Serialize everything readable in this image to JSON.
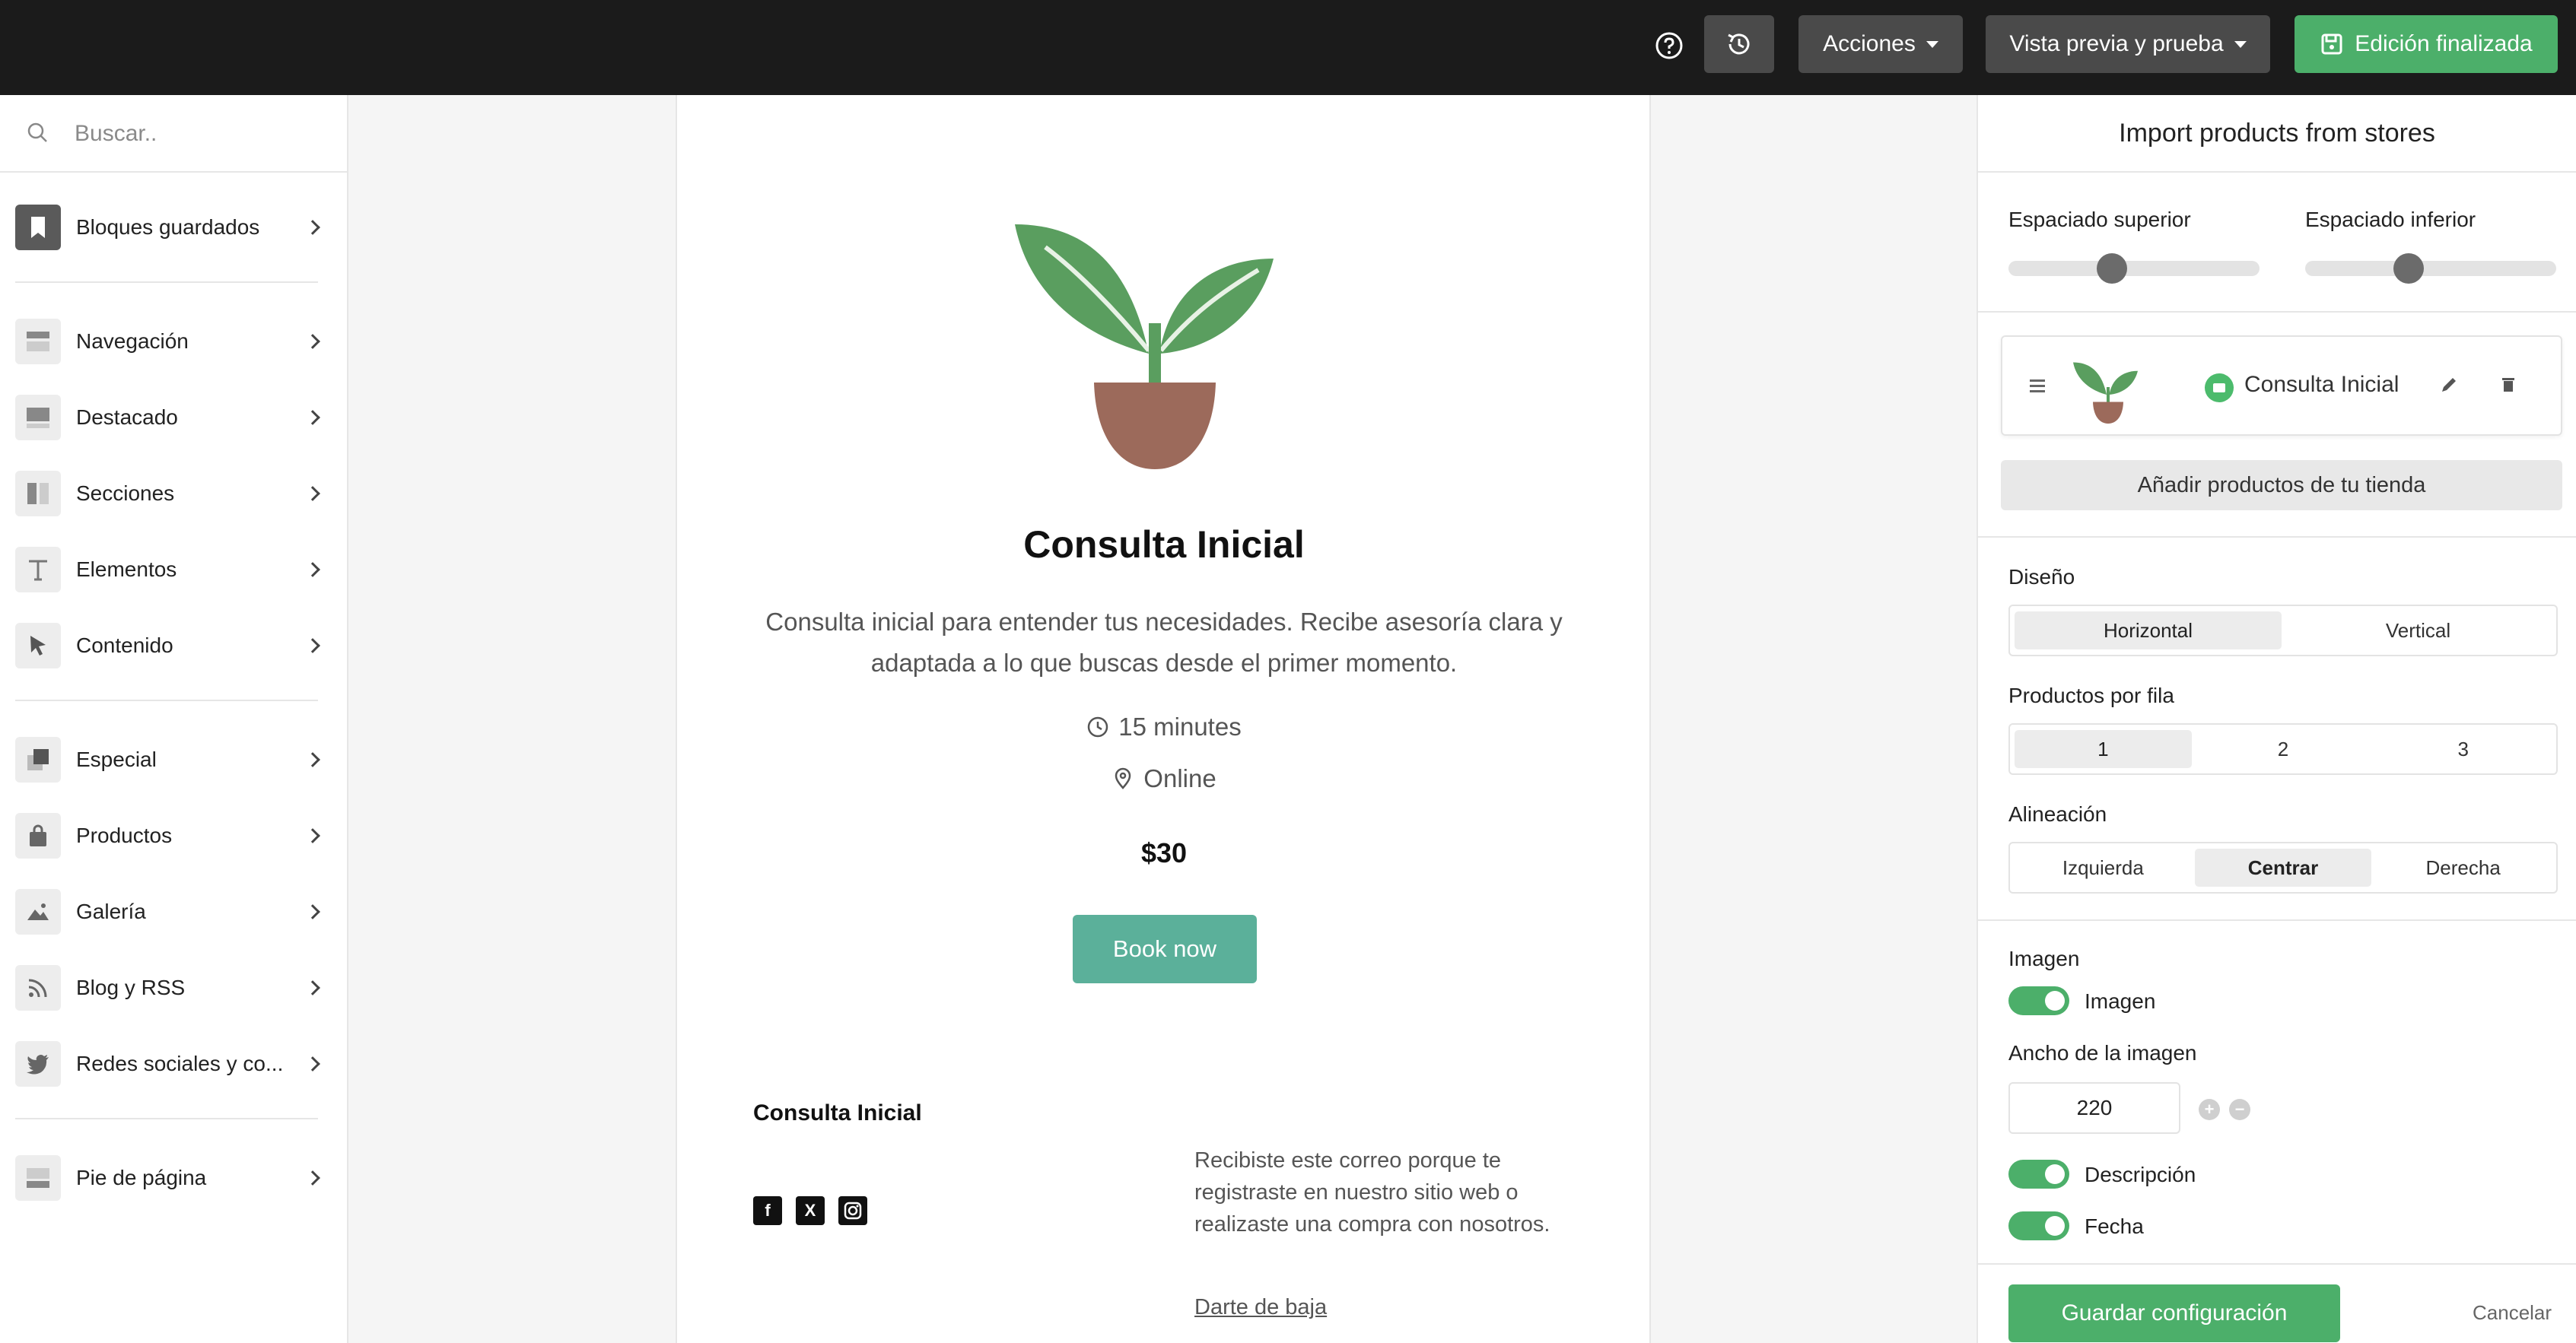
{
  "topbar": {
    "actions_label": "Acciones",
    "preview_label": "Vista previa y prueba",
    "finish_label": "Edición finalizada"
  },
  "sidebar": {
    "search_placeholder": "Buscar..",
    "items": [
      {
        "label": "Bloques guardados",
        "icon": "bookmark-icon"
      },
      {
        "label": "Navegación",
        "icon": "navigation-icon"
      },
      {
        "label": "Destacado",
        "icon": "featured-icon"
      },
      {
        "label": "Secciones",
        "icon": "sections-icon"
      },
      {
        "label": "Elementos",
        "icon": "text-icon"
      },
      {
        "label": "Contenido",
        "icon": "cursor-icon"
      },
      {
        "label": "Especial",
        "icon": "special-icon"
      },
      {
        "label": "Productos",
        "icon": "bag-icon"
      },
      {
        "label": "Galería",
        "icon": "image-icon"
      },
      {
        "label": "Blog y RSS",
        "icon": "rss-icon"
      },
      {
        "label": "Redes sociales y co...",
        "icon": "twitter-icon"
      },
      {
        "label": "Pie de página",
        "icon": "footer-icon"
      }
    ]
  },
  "email": {
    "title": "Consulta Inicial",
    "description": "Consulta inicial para entender tus necesidades. Recibe asesoría clara y adaptada a lo que buscas desde el primer momento.",
    "duration": "15 minutes",
    "location": "Online",
    "price": "$30",
    "button_label": "Book now",
    "footer_title": "Consulta Inicial",
    "footer_note": "Recibiste este correo porque te registraste en nuestro sitio web o realizaste una compra con nosotros.",
    "unsubscribe": "Darte de baja",
    "social": [
      "facebook-icon",
      "x-icon",
      "instagram-icon"
    ]
  },
  "panel": {
    "title": "Import products from stores",
    "spacing_top_label": "Espaciado superior",
    "spacing_bottom_label": "Espaciado inferior",
    "spacing_top_level": 0.4,
    "spacing_bottom_level": 0.4,
    "product_name": "Consulta Inicial",
    "add_products_label": "Añadir productos de tu tienda",
    "design_label": "Diseño",
    "design_options": [
      "Horizontal",
      "Vertical"
    ],
    "design_selected": "Horizontal",
    "per_row_label": "Productos por fila",
    "per_row_options": [
      "1",
      "2",
      "3"
    ],
    "per_row_selected": "1",
    "align_label": "Alineación",
    "align_options": [
      "Izquierda",
      "Centrar",
      "Derecha"
    ],
    "align_selected": "Centrar",
    "image_section_label": "Imagen",
    "image_toggle_label": "Imagen",
    "image_width_label": "Ancho de la imagen",
    "image_width_value": "220",
    "description_toggle_label": "Descripción",
    "date_toggle_label": "Fecha",
    "save_label": "Guardar configuración",
    "cancel_label": "Cancelar"
  },
  "colors": {
    "accent_green": "#4caf6a",
    "book_button": "#5bb09a",
    "leaf": "#5a9e5f",
    "pot": "#9c6a5b"
  }
}
